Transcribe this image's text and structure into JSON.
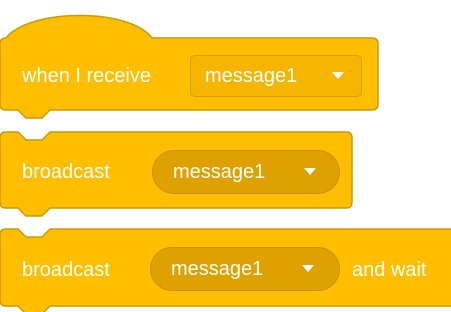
{
  "colors": {
    "block_fill": "#ffbf00",
    "block_stroke": "#cc9900",
    "dropdown_fill": "#dea100",
    "text": "#ffffff"
  },
  "blocks": [
    {
      "type": "hat",
      "label": "when I receive",
      "dropdown": {
        "value": "message1",
        "icon": "caret-down-icon"
      }
    },
    {
      "type": "stack",
      "label": "broadcast",
      "dropdown": {
        "value": "message1",
        "icon": "caret-down-icon"
      }
    },
    {
      "type": "stack",
      "label": "broadcast",
      "dropdown": {
        "value": "message1",
        "icon": "caret-down-icon"
      },
      "suffix": "and wait"
    }
  ]
}
